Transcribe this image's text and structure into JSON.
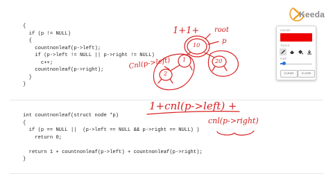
{
  "code": {
    "top_block": "{\n  if (p != NULL)\n  {\n    countnonleaf(p->left);\n    if (p->left != NULL || p->right != NULL)\n      c++;\n    countnonleaf(p->right);\n  }\n}",
    "bottom_block": "int countnonleaf(struct node *p)\n{\n  if (p == NULL ||  (p->left == NULL && p->right == NULL) )\n    return 0;\n\n  return 1 + countnonleaf(p->left) + countnonleaf(p->right);\n}"
  },
  "annotations": {
    "count_label": "1+1+",
    "root_label": "root",
    "p_label": "p",
    "node_root": "10",
    "node_left": "1",
    "node_right": "20",
    "node_leftleft": "2",
    "cnl_left_label": "Cnl(p->left)",
    "formula_top": "1+cnl(p->left) +",
    "formula_bottom": "cnl(p->right)"
  },
  "logo": {
    "brand": "Keeda"
  },
  "color_panel": {
    "color_label": "COLOR",
    "tools_label": "TOOLS",
    "size_label": "SIZE",
    "selected_color": "#ee0000",
    "tools": [
      "pen-icon",
      "eraser-icon",
      "fill-icon",
      "download-icon"
    ],
    "active_tool": "pen-icon",
    "size_fraction": 0.12,
    "clear_label": "CLEAR",
    "close_label": "CLOSE"
  }
}
